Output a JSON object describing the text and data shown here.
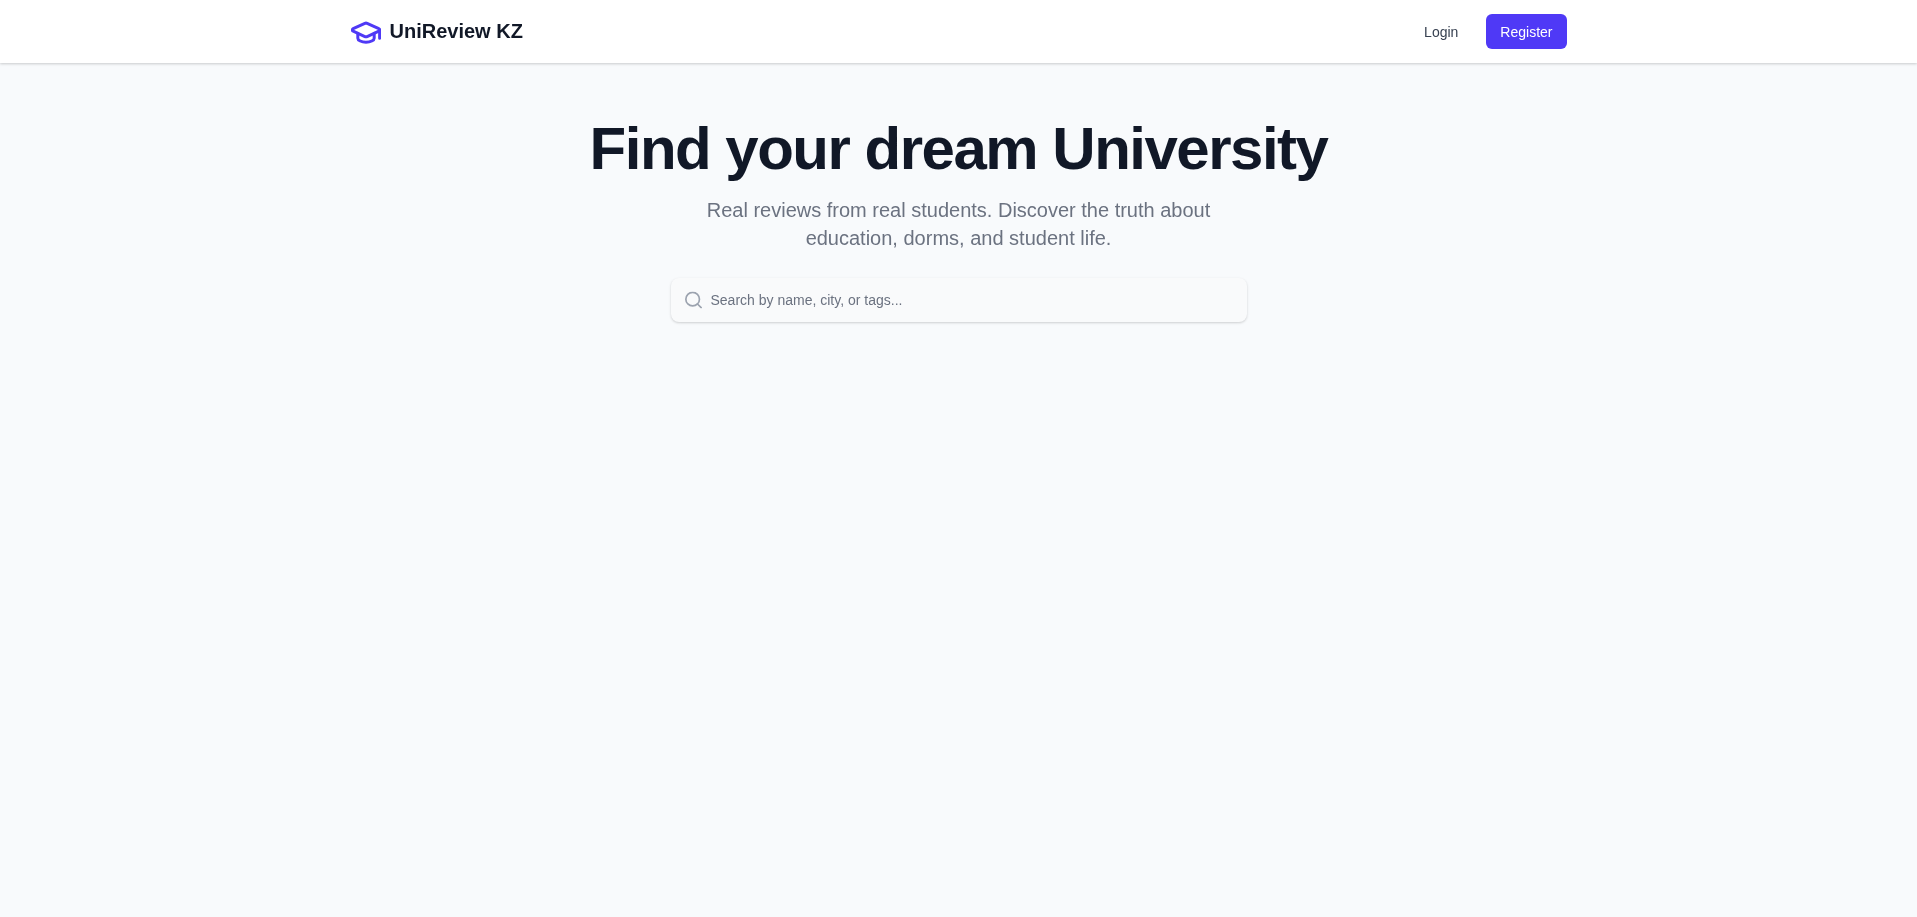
{
  "navbar": {
    "brand": "UniReview KZ",
    "links": [
      {
        "label": "Login",
        "kind": "link"
      },
      {
        "label": "Register",
        "kind": "primary"
      }
    ]
  },
  "hero": {
    "title": "Find your dream University",
    "subtitle": "Real reviews from real students. Discover the truth about education, dorms, and student life."
  },
  "search": {
    "placeholder": "Search by name, city, or tags..."
  }
}
